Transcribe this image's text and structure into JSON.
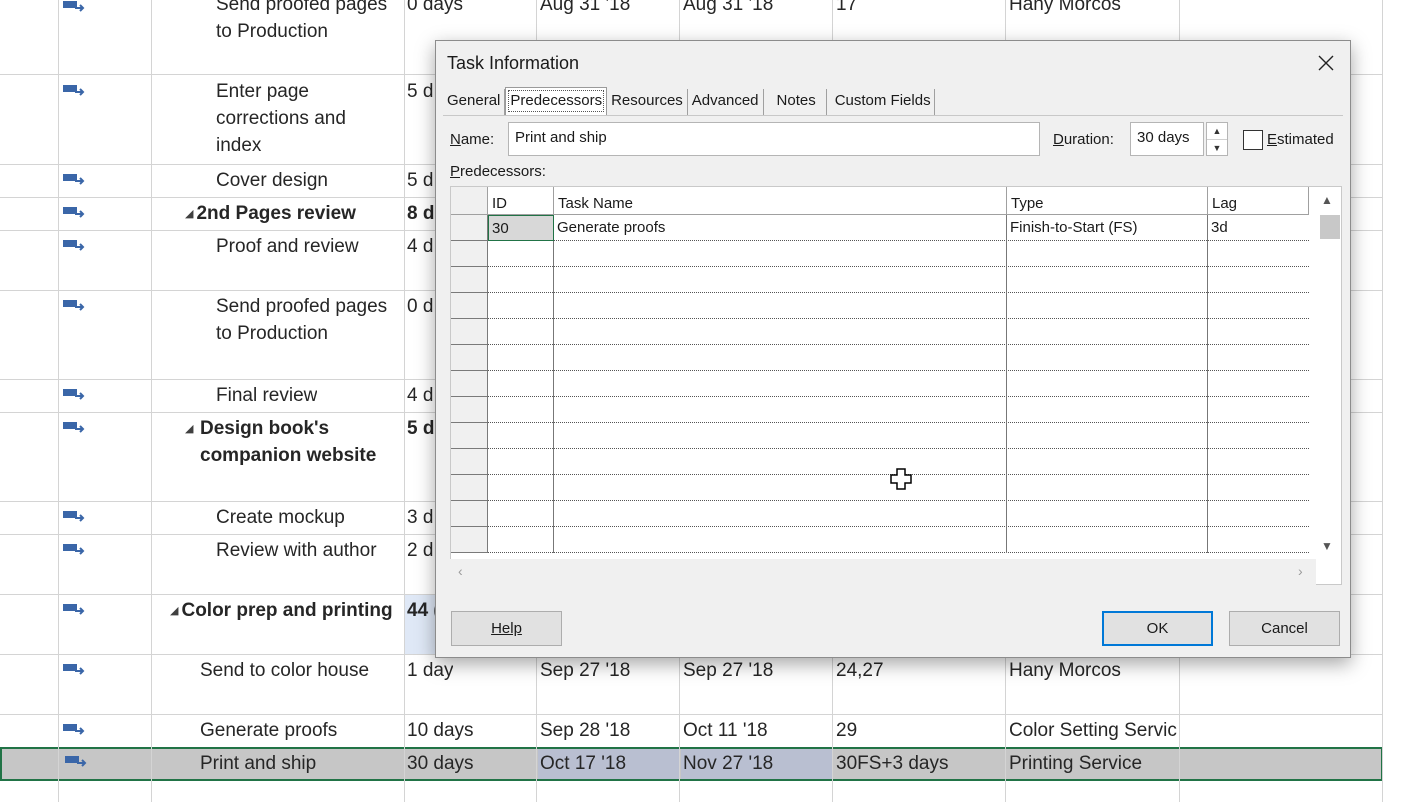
{
  "project_rows": [
    {
      "name": "Send proofed pages to Production",
      "duration": "0 days",
      "start": "Aug 31 '18",
      "finish": "Aug 31 '18",
      "predecessors": "17",
      "resources": "Hany Morcos"
    },
    {
      "name": "Enter page corrections and index",
      "duration": "5 d"
    },
    {
      "name": "Cover design",
      "duration": "5 d"
    },
    {
      "name": "2nd Pages review",
      "duration": "8 d"
    },
    {
      "name": "Proof and review",
      "duration": "4 d"
    },
    {
      "name": "Send proofed pages to Production",
      "duration": "0 d"
    },
    {
      "name": "Final review",
      "duration": "4 d"
    },
    {
      "name": "Design book's companion website",
      "duration": "5 d"
    },
    {
      "name": "Create mockup",
      "duration": "3 d"
    },
    {
      "name": "Review with author",
      "duration": "2 d"
    },
    {
      "name": "Color prep and printing",
      "duration": "44 ("
    },
    {
      "name": "Send to color house",
      "duration": "1 day",
      "start": "Sep 27 '18",
      "finish": "Sep 27 '18",
      "predecessors": "24,27",
      "resources": "Hany Morcos"
    },
    {
      "name": "Generate proofs",
      "duration": "10 days",
      "start": "Sep 28 '18",
      "finish": "Oct 11 '18",
      "predecessors": "29",
      "resources": "Color Setting Servic"
    },
    {
      "name": "Print and ship",
      "duration": "30 days",
      "start": "Oct 17 '18",
      "finish": "Nov 27 '18",
      "predecessors": "30FS+3 days",
      "resources": "Printing Service"
    }
  ],
  "dialog": {
    "title": "Task Information",
    "tabs": [
      "General",
      "Predecessors",
      "Resources",
      "Advanced",
      "Notes",
      "Custom Fields"
    ],
    "active_tab": "Predecessors",
    "name_label_key": "N",
    "name_label_rest": "ame:",
    "name_value": "Print and ship",
    "duration_label_key": "D",
    "duration_label_rest": "uration:",
    "duration_value": "30 days",
    "estimated_label_key": "E",
    "estimated_label_rest": "stimated",
    "estimated_checked": false,
    "predecessors_label_key": "P",
    "predecessors_label_rest": "redecessors:",
    "table_headers": {
      "id": "ID",
      "task_name": "Task Name",
      "type": "Type",
      "lag": "Lag"
    },
    "predecessors": [
      {
        "id": "30",
        "task_name": "Generate proofs",
        "type": "Finish-to-Start (FS)",
        "lag": "3d"
      }
    ],
    "help_label": "Help",
    "ok_label": "OK",
    "cancel_label": "Cancel"
  }
}
